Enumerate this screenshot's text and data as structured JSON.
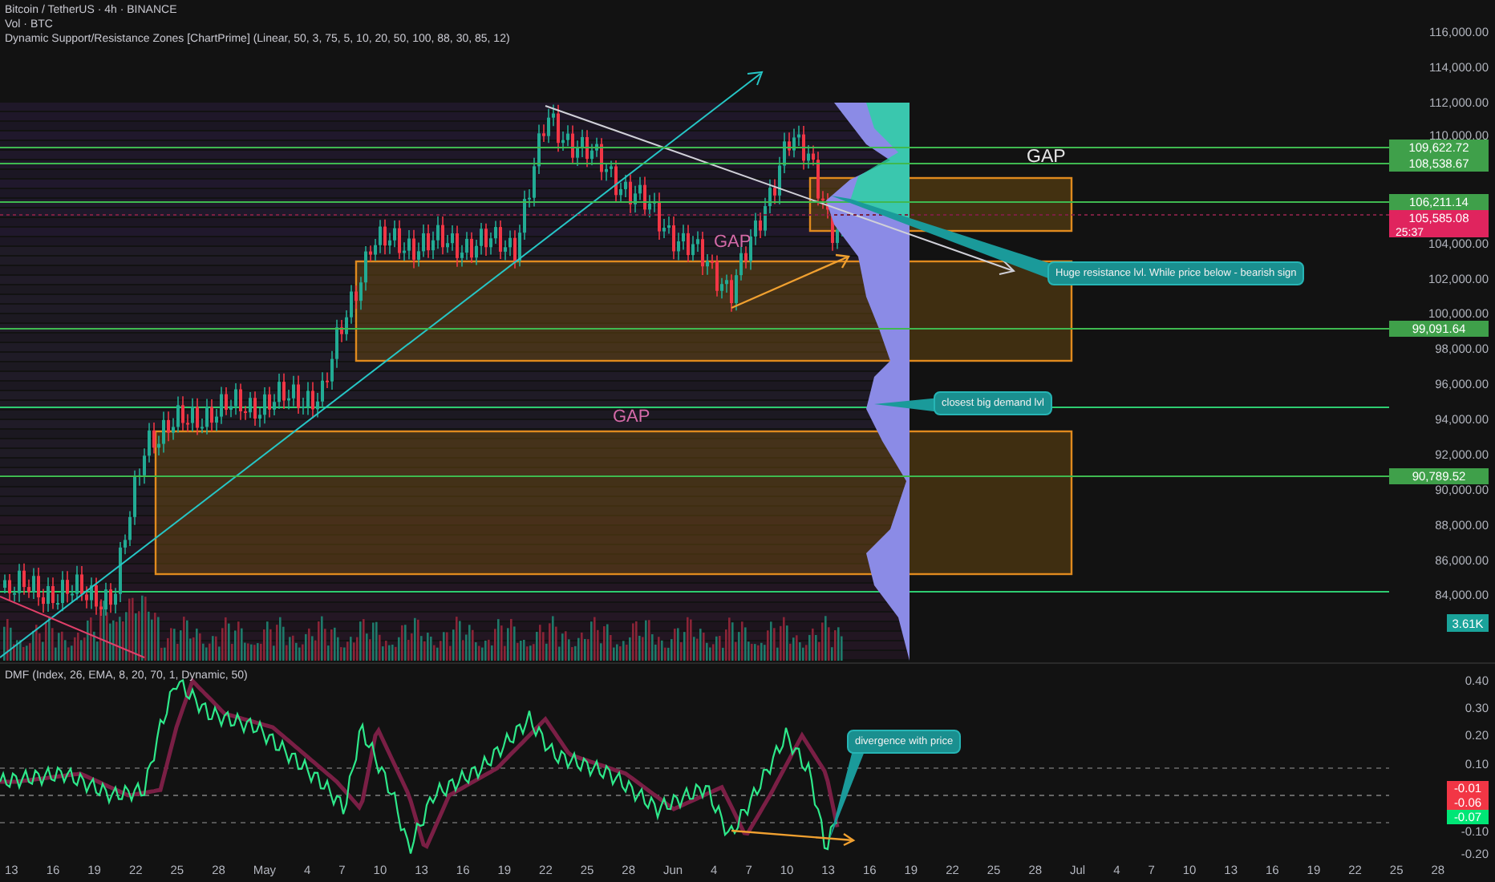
{
  "legend": [
    "Bitcoin / TetherUS · 4h · BINANCE",
    "Vol · BTC",
    "Dynamic Support/Resistance Zones [ChartPrime] (Linear, 50, 3, 75, 5, 10, 20, 50, 100, 88, 30, 85, 12)"
  ],
  "price_axis": {
    "ticks": [
      "116,000.00",
      "114,000.00",
      "112,000.00",
      "110,000.00",
      "104,000.00",
      "102,000.00",
      "100,000.00",
      "98,000.00",
      "96,000.00",
      "94,000.00",
      "92,000.00",
      "90,000.00",
      "88,000.00",
      "86,000.00",
      "84,000.00"
    ]
  },
  "price_tags": [
    {
      "kind": "level",
      "text": "109,622.72"
    },
    {
      "kind": "level",
      "text": "108,538.67"
    },
    {
      "kind": "level",
      "text": "106,211.14"
    },
    {
      "kind": "last",
      "text": "105,585.08",
      "countdown": "25:37"
    },
    {
      "kind": "level",
      "text": "99,091.64"
    },
    {
      "kind": "level",
      "text": "90,789.52"
    }
  ],
  "volume_tag": "3.61K",
  "gap_labels": [
    {
      "kind": "large",
      "text": "GAP"
    },
    {
      "kind": "small",
      "text": "GAP"
    },
    {
      "kind": "small",
      "text": "GAP"
    }
  ],
  "callouts": [
    "Huge resistance lvl. While price below - bearish sign",
    "closest big demand lvl"
  ],
  "dmf": {
    "legend": "DMF (Index, 26, EMA, 8, 20, 70, 1, Dynamic, 50)",
    "ticks": [
      "0.40",
      "0.30",
      "0.20",
      "0.10",
      "-0.10",
      "-0.20"
    ],
    "value_tags": [
      {
        "text": "-0.01",
        "color": "#f23645"
      },
      {
        "text": "-0.06",
        "color": "#f23645"
      },
      {
        "text": "-0.07",
        "color": "#00e676"
      }
    ],
    "callout": "divergence with price"
  },
  "time_axis": [
    "13",
    "16",
    "19",
    "22",
    "25",
    "28",
    "May",
    "4",
    "7",
    "10",
    "13",
    "16",
    "19",
    "22",
    "25",
    "28",
    "Jun",
    "4",
    "7",
    "10",
    "13",
    "16",
    "19",
    "22",
    "25",
    "28",
    "Jul",
    "4",
    "7",
    "10",
    "13",
    "16",
    "19",
    "22",
    "25",
    "28"
  ]
}
